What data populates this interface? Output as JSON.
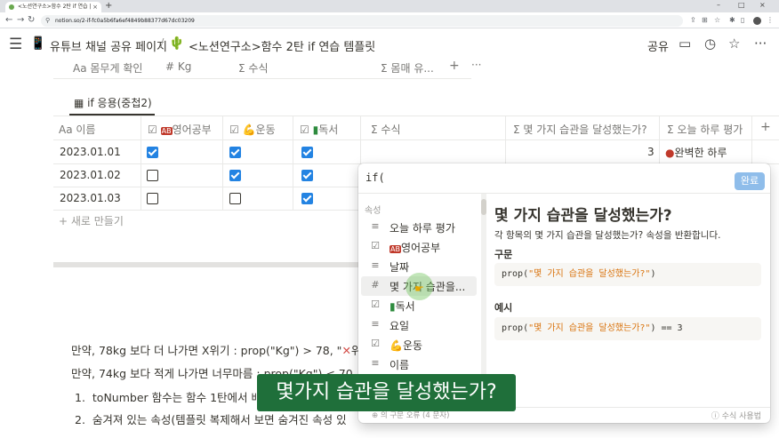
{
  "browser": {
    "tab_title": "<노션연구소>함수 2탄 if 연습 |",
    "tab_close": "×",
    "new_tab": "+",
    "url": "notion.so/2-if-fc0a5b6fa6ef4849b88377d67dc03209",
    "window_controls": [
      "–",
      "□",
      "×"
    ]
  },
  "header": {
    "crumb1": "유튜브 채널 공유 페이지",
    "crumb_sep": "/",
    "crumb2": "<노션연구소>함수 2탄 if 연습 템플릿",
    "share": "공유"
  },
  "top_props": [
    "몸무게 확인",
    "Kg",
    "수식",
    "몸매 유..."
  ],
  "top_prop_icons": [
    "Aa",
    "#",
    "Σ",
    "Σ"
  ],
  "view_tab": "if 응용(중첩2)",
  "columns": [
    {
      "icon": "Aa",
      "label": "이름"
    },
    {
      "icon": "☑",
      "label": "영어공부"
    },
    {
      "icon": "☑",
      "label": "운동"
    },
    {
      "icon": "☑",
      "label": "독서"
    },
    {
      "icon": "Σ",
      "label": "수식"
    },
    {
      "icon": "Σ",
      "label": "몇 가지 습관을 달성했는가?"
    },
    {
      "icon": "Σ",
      "label": "오늘 하루 평가"
    }
  ],
  "rows": [
    {
      "date": "2023.01.01",
      "english": true,
      "exercise": true,
      "reading": true
    },
    {
      "date": "2023.01.02",
      "english": false,
      "exercise": true,
      "reading": true
    },
    {
      "date": "2023.01.03",
      "english": false,
      "exercise": false,
      "reading": true
    }
  ],
  "row1_count": "3",
  "row1_eval": "완벽한 하루",
  "new_row": "+ 새로 만들기",
  "body_lines": {
    "line1a": "만약, 78kg 보다 더 나가면 X위기 : prop(\"Kg\") > 78, \"",
    "line1b": "위기",
    "line2": "만약, 74kg 보다 적게 나가면 너무마름 : prop(\"Kg\") < 70, \"",
    "item1_num": "1.",
    "item1": "toNumber 함수는 함수 1탄에서 배",
    "item2_num": "2.",
    "item2": "숨겨져 있는 속성(템플릿 복제해서 보면 숨겨진 속성 있"
  },
  "editor": {
    "formula": "if(",
    "done": "완료",
    "section": "속성",
    "properties": [
      {
        "icon": "≡",
        "label": "오늘 하루 평가"
      },
      {
        "icon": "☑",
        "label": "영어공부"
      },
      {
        "icon": "≡",
        "label": "날짜"
      },
      {
        "icon": "#",
        "label": "몇 가지 습관을..."
      },
      {
        "icon": "☑",
        "label": "독서"
      },
      {
        "icon": "≡",
        "label": "요일"
      },
      {
        "icon": "☑",
        "label": "운동"
      },
      {
        "icon": "≡",
        "label": "이름"
      }
    ],
    "doc_title": "몇 가지 습관을 달성했는가?",
    "doc_desc": "각 항목의 몇 가지 습관을 달성했는가? 속성을 반환합니다.",
    "syntax_label": "구문",
    "syntax_prefix": "prop(",
    "syntax_str": "\"몇 가지 습관을 달성했는가?\"",
    "syntax_suffix": ")",
    "example_label": "예시",
    "example_prefix": "prop(",
    "example_str": "\"몇 가지 습관을 달성했는가?\"",
    "example_suffix": ") == 3",
    "foot_left": "⊕ 의 구문 오류 (4 문자)",
    "foot_right": "ⓘ 수식 사용법"
  },
  "subtitle": "몇가지 습관을 달성했는가?",
  "colors": {
    "checkbox": "#2383e2",
    "subtitle_bg": "#1f6f3a",
    "done_btn": "#8fbdea"
  }
}
